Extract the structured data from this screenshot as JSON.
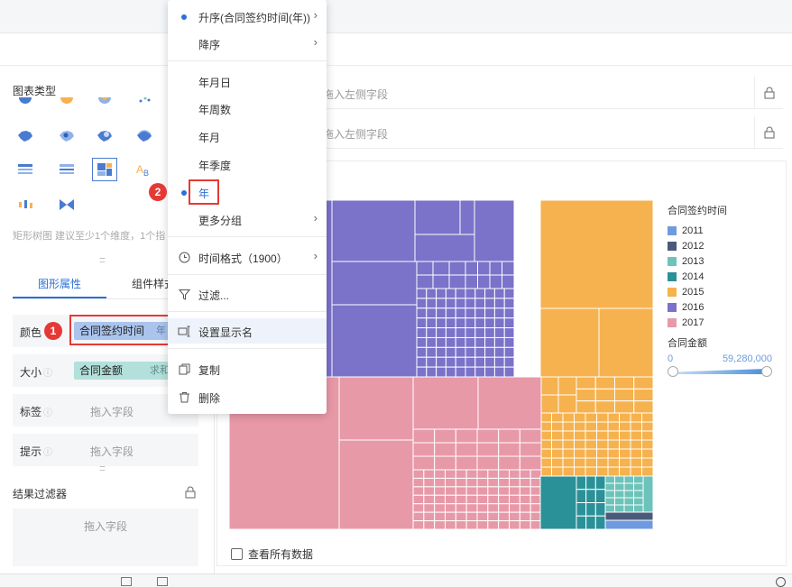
{
  "left": {
    "chart_type_title": "图表类型",
    "hint": "矩形树图 建议至少1个维度，1个指",
    "tabs": [
      "图形属性",
      "组件样式"
    ],
    "props": [
      {
        "label": "颜色",
        "field": "合同签约时间",
        "suffix": "年"
      },
      {
        "label": "大小",
        "field": "合同金额",
        "suffix": "求和"
      },
      {
        "label": "标签",
        "placeholder": "拖入字段"
      },
      {
        "label": "提示",
        "placeholder": "拖入字段"
      }
    ],
    "filter_title": "结果过滤器",
    "filter_placeholder": "拖入字段"
  },
  "axis": {
    "x_placeholder": "拖入左侧字段",
    "y_placeholder": "拖入左侧字段"
  },
  "menu": {
    "asc": "升序(合同签约时间(年))",
    "desc": "降序",
    "ymd": "年月日",
    "yweek": "年周数",
    "ym": "年月",
    "yq": "年季度",
    "year": "年",
    "more": "更多分组",
    "timefmt": "时间格式（1900）",
    "filter": "过滤...",
    "rename": "设置显示名",
    "copy": "复制",
    "delete": "删除"
  },
  "badges": {
    "one": "1",
    "two": "2"
  },
  "legend": {
    "color_title": "合同签约时间",
    "items": [
      {
        "label": "2011",
        "color": "#6e9be0"
      },
      {
        "label": "2012",
        "color": "#4a5a7a"
      },
      {
        "label": "2013",
        "color": "#6cc3b9"
      },
      {
        "label": "2014",
        "color": "#2a9198"
      },
      {
        "label": "2015",
        "color": "#f6b24e"
      },
      {
        "label": "2016",
        "color": "#7b72c9"
      },
      {
        "label": "2017",
        "color": "#e899a8"
      }
    ],
    "size_title": "合同金额",
    "size_min": "0",
    "size_max": "59,280,000"
  },
  "show_all": "查看所有数据",
  "chart_data": {
    "type": "treemap",
    "color_field": "合同签约时间",
    "size_field": "合同金额",
    "size_range": [
      0,
      59280000
    ]
  }
}
